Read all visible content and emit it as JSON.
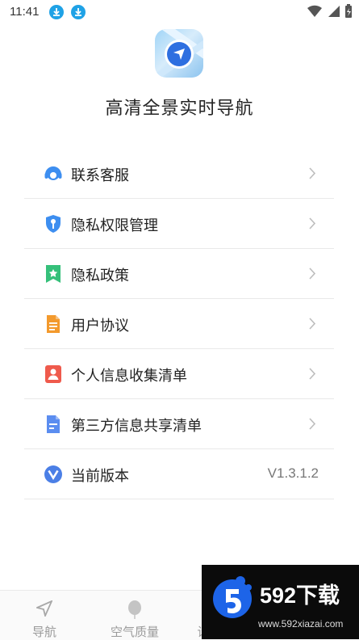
{
  "status_bar": {
    "time": "11:41"
  },
  "app": {
    "title": "高清全景实时导航"
  },
  "menu": {
    "items": [
      {
        "label": "联系客服",
        "icon": "headset-icon"
      },
      {
        "label": "隐私权限管理",
        "icon": "shield-key-icon"
      },
      {
        "label": "隐私政策",
        "icon": "bookmark-star-icon"
      },
      {
        "label": "用户协议",
        "icon": "document-icon"
      },
      {
        "label": "个人信息收集清单",
        "icon": "person-card-icon"
      },
      {
        "label": "第三方信息共享清单",
        "icon": "list-document-icon"
      },
      {
        "label": "当前版本",
        "icon": "version-v-icon",
        "value": "V1.3.1.2"
      }
    ]
  },
  "tab_bar": {
    "tabs": [
      {
        "label": "导航",
        "icon": "navigation-arrow-icon"
      },
      {
        "label": "空气质量",
        "icon": "balloon-icon"
      },
      {
        "label": "设",
        "icon": "settings-icon"
      }
    ]
  },
  "watermark": {
    "brand": "592下载",
    "url": "www.592xiazai.com"
  },
  "colors": {
    "download_badge": "#1fa2e6",
    "text_primary": "#222222",
    "text_secondary": "#777777",
    "divider": "#e9e9e9",
    "tab_inactive": "#9a9a9a"
  }
}
